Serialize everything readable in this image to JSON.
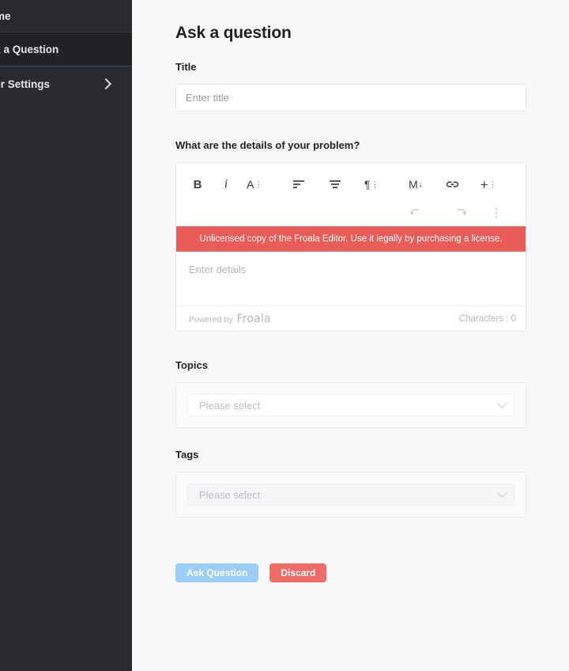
{
  "sidebar": {
    "items": [
      {
        "label": "Home",
        "icon": "",
        "active": false
      },
      {
        "label": "Ask a Question",
        "icon": "",
        "active": true
      },
      {
        "label": "User Settings",
        "icon": "chevron-right-icon",
        "active": false
      }
    ]
  },
  "main": {
    "page_title": "Ask a question",
    "title_field": {
      "label": "Title",
      "value": "",
      "placeholder": "Enter title"
    },
    "details_field": {
      "label": "What are the details of your problem?",
      "placeholder": "Enter details"
    },
    "editor": {
      "toolbar": [
        {
          "name": "bold-icon",
          "glyph": "B"
        },
        {
          "name": "italic-icon",
          "glyph": "i"
        },
        {
          "name": "text-color-icon",
          "glyph": "A"
        },
        {
          "name": "align-left-icon",
          "glyph": ""
        },
        {
          "name": "line-height-icon",
          "glyph": ""
        },
        {
          "name": "paragraph-format-icon",
          "glyph": "¶"
        },
        {
          "name": "markdown-icon",
          "glyph": "M"
        },
        {
          "name": "insert-link-icon",
          "glyph": ""
        },
        {
          "name": "more-rich-icon",
          "glyph": "+"
        },
        {
          "name": "undo-icon",
          "glyph": ""
        },
        {
          "name": "redo-icon",
          "glyph": ""
        },
        {
          "name": "more-misc-icon",
          "glyph": ""
        }
      ],
      "license_banner": "Unlicensed copy of the Froala Editor. Use it legally by purchasing a license.",
      "powered_by_prefix": "Powered by",
      "powered_by_brand": "Froala",
      "character_count": "Characters : 0"
    },
    "topics_field": {
      "label": "Topics",
      "placeholder": "Please select",
      "value": ""
    },
    "tags_field": {
      "label": "Tags",
      "placeholder": "Please select",
      "value": ""
    },
    "actions": {
      "submit_label": "Ask Question",
      "discard_label": "Discard"
    }
  },
  "colors": {
    "sidebar_bg": "#282a30",
    "sidebar_active_bg": "#212226",
    "page_bg": "#f8f8f9",
    "license_banner_bg": "#ea5c58",
    "primary_button_bg": "#9bcdf5",
    "danger_button_bg": "#ef6b68"
  }
}
